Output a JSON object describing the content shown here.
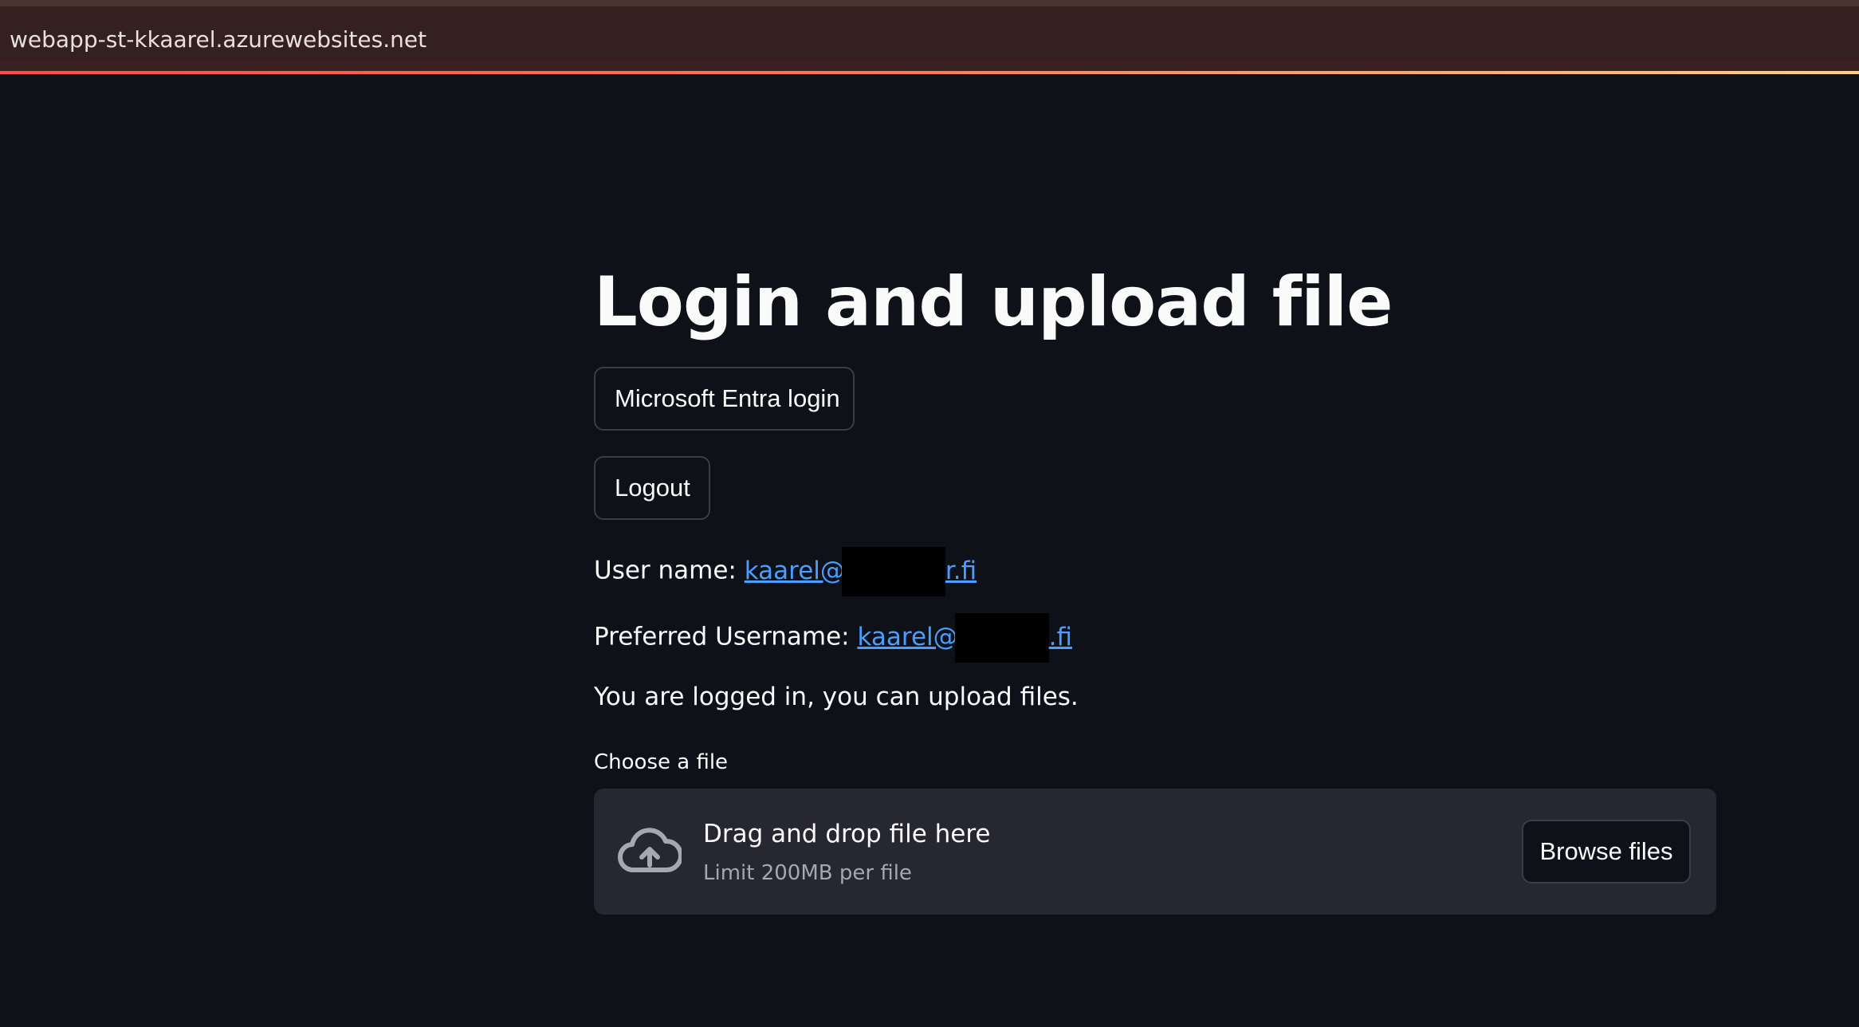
{
  "browser": {
    "url": "webapp-st-kkaarel.azurewebsites.net",
    "site_icon": "site-info-icon"
  },
  "page": {
    "title": "Login and upload file",
    "login_button": "Microsoft Entra login",
    "logout_button": "Logout",
    "username_label": "User name:",
    "username_prefix": "kaarel@",
    "username_suffix": "r.fi",
    "preferred_label": "Preferred Username:",
    "preferred_prefix": "kaarel@",
    "preferred_suffix": ".fi",
    "status_text": "You are logged in, you can upload files."
  },
  "uploader": {
    "label": "Choose a file",
    "drop_title": "Drag and drop file here",
    "limit_text": "Limit 200MB per file",
    "browse_button": "Browse files",
    "icon": "cloud-upload-icon"
  },
  "colors": {
    "background": "#0e1117",
    "link": "#4a9eff",
    "dropzone": "#262730"
  }
}
